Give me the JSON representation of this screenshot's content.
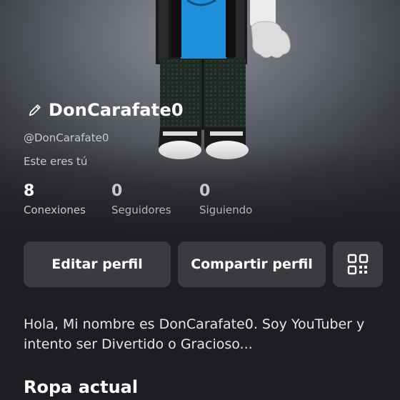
{
  "profile": {
    "display_name": "DonCarafate0",
    "username": "@DonCarafate0",
    "self_note": "Este eres tú"
  },
  "stats": [
    {
      "value": "8",
      "label": "Conexiones"
    },
    {
      "value": "0",
      "label": "Seguidores"
    },
    {
      "value": "0",
      "label": "Siguiendo"
    }
  ],
  "actions": {
    "edit_label": "Editar perfil",
    "share_label": "Compartir perfil",
    "qr_icon": "qr-code-icon"
  },
  "bio": "Hola, Mi nombre es DonCarafate0. Soy YouTuber y intento ser Divertido o Gracioso...",
  "sections": {
    "current_outfit": "Ropa actual"
  },
  "colors": {
    "background": "#1d1e22",
    "button": "#393b3f",
    "muted_text": "#c8c9cd",
    "avatar_shirt": "#1f8fdc"
  }
}
